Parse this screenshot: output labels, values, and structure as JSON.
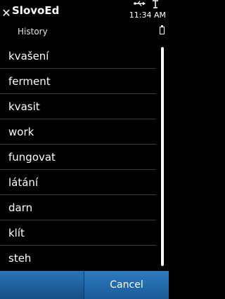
{
  "header": {
    "title": "SlovoEd",
    "subtitle": "History",
    "time": "11:34 AM",
    "close_icon": "close-icon"
  },
  "history": {
    "items": [
      {
        "label": "kvašení"
      },
      {
        "label": "ferment"
      },
      {
        "label": "kvasit"
      },
      {
        "label": "work"
      },
      {
        "label": "fungovat"
      },
      {
        "label": "látání"
      },
      {
        "label": "darn"
      },
      {
        "label": "klít"
      },
      {
        "label": "steh"
      }
    ]
  },
  "softkeys": {
    "left_label": "",
    "right_label": "Cancel"
  },
  "colors": {
    "background": "#000000",
    "softkey_bar": "#1c65a6",
    "divider": "#3a3a3a"
  }
}
